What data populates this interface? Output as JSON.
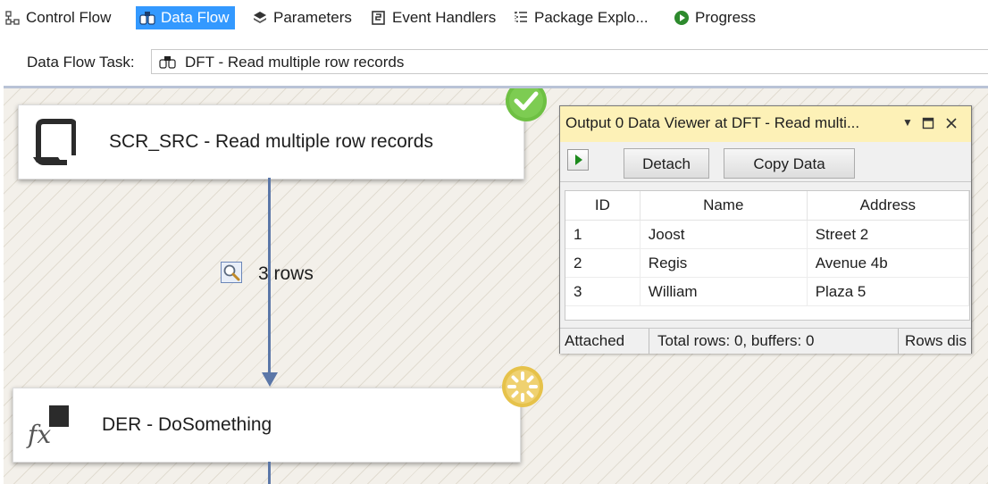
{
  "tabs": [
    {
      "label": "Control Flow",
      "icon": "control-flow-icon",
      "active": false
    },
    {
      "label": "Data Flow",
      "icon": "data-flow-icon",
      "active": true
    },
    {
      "label": "Parameters",
      "icon": "parameters-icon",
      "active": false
    },
    {
      "label": "Event Handlers",
      "icon": "event-handlers-icon",
      "active": false
    },
    {
      "label": "Package Explo...",
      "icon": "package-explorer-icon",
      "active": false
    },
    {
      "label": "Progress",
      "icon": "progress-icon",
      "active": false
    }
  ],
  "task_selector": {
    "label": "Data Flow Task:",
    "value": "DFT - Read multiple row records",
    "icon": "data-flow-task-icon"
  },
  "components": {
    "source": {
      "title": "SCR_SRC - Read multiple row records",
      "icon": "script-component-icon",
      "status": "success-check-icon"
    },
    "derived": {
      "title": "DER - DoSomething",
      "icon": "derived-column-fx-icon",
      "status": "in-progress-icon"
    }
  },
  "path": {
    "rows_label": "3 rows",
    "icon": "data-viewer-magnifier-icon"
  },
  "viewer": {
    "title": "Output 0 Data Viewer at DFT - Read multi...",
    "buttons": {
      "detach": "Detach",
      "copy": "Copy Data"
    },
    "columns": [
      "ID",
      "Name",
      "Address"
    ],
    "rows": [
      {
        "id": "1",
        "name": "Joost",
        "address": "Street 2"
      },
      {
        "id": "2",
        "name": "Regis",
        "address": "Avenue 4b"
      },
      {
        "id": "3",
        "name": "William",
        "address": "Plaza 5"
      }
    ],
    "status": {
      "attached": "Attached",
      "totals": "Total rows: 0, buffers: 0",
      "rows_dis": "Rows dis"
    }
  },
  "colors": {
    "active_tab": "#3399ff",
    "viewer_title": "#fdf1b7",
    "success": "#6ec043",
    "connector": "#5b77a8"
  }
}
